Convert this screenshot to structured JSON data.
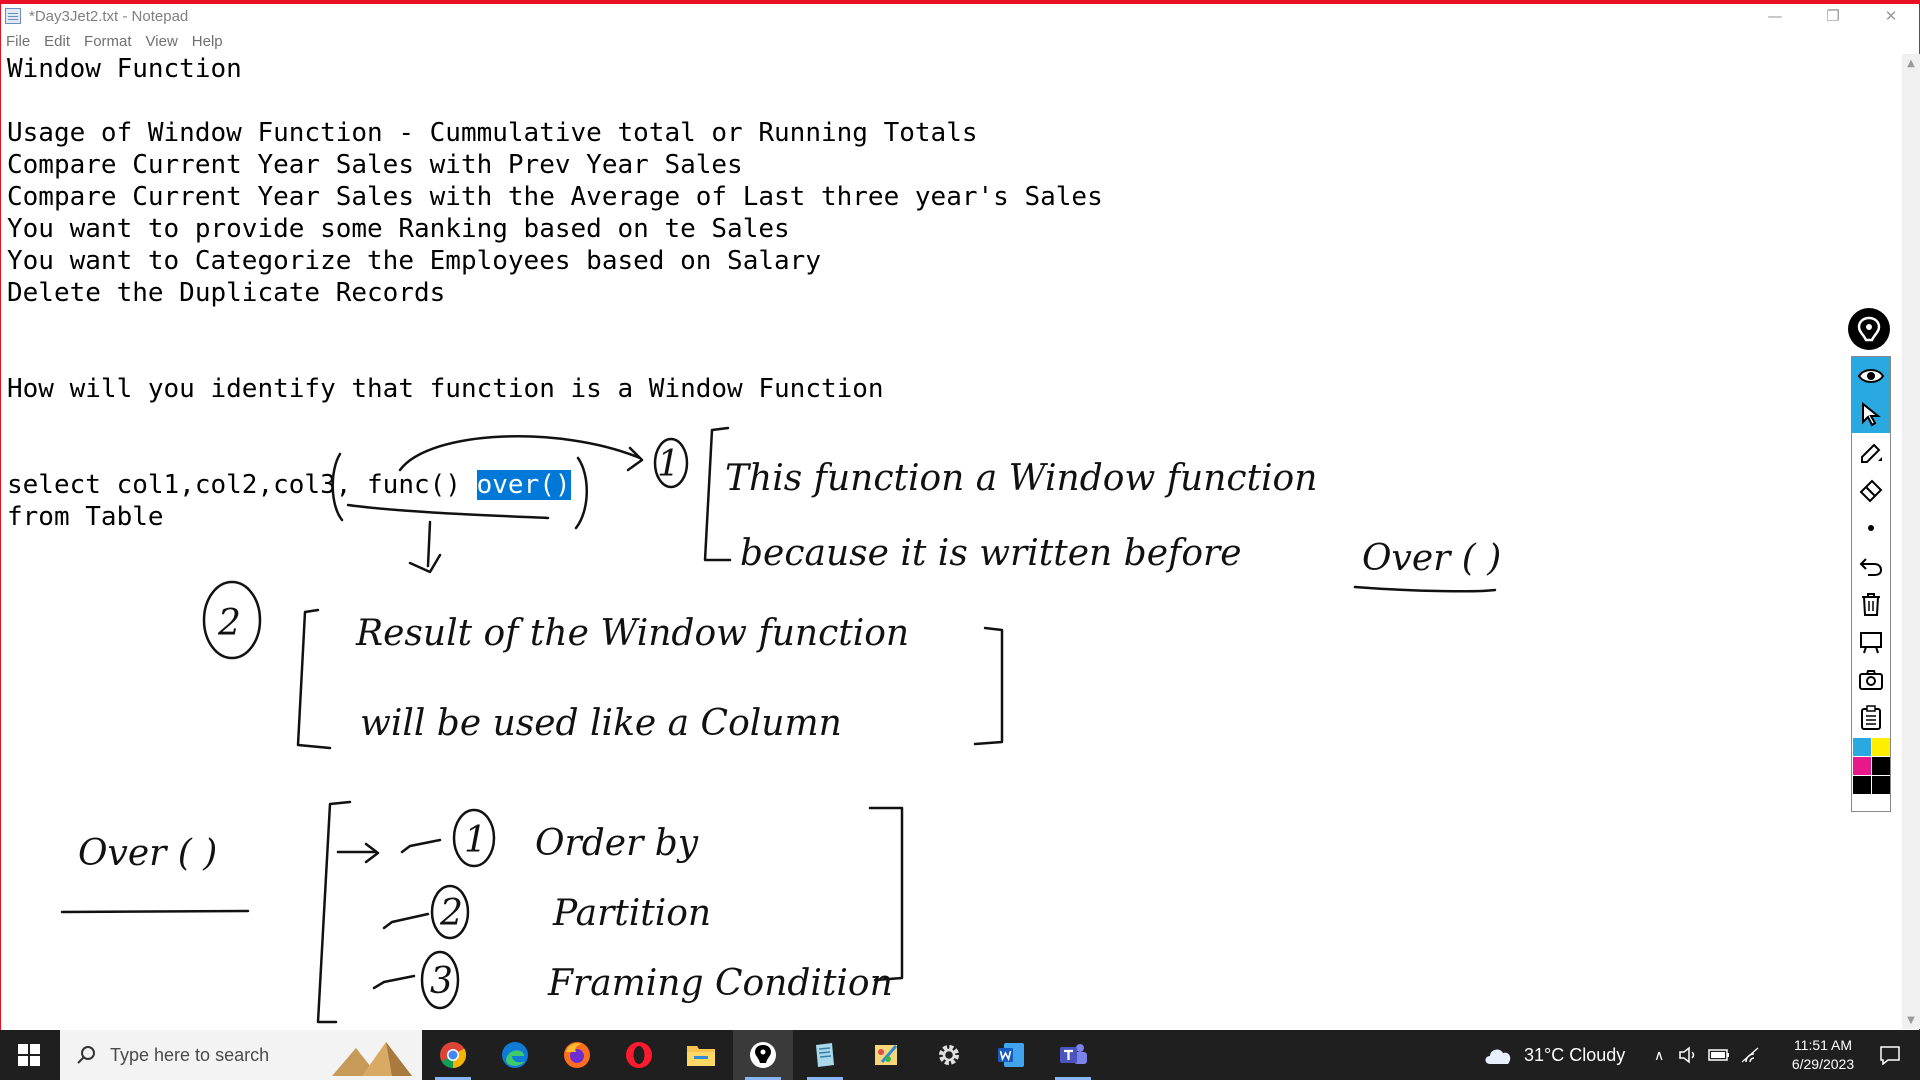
{
  "window": {
    "title": "*Day3Jet2.txt - Notepad",
    "controls": {
      "minimize": "—",
      "maximize": "❐",
      "close": "✕"
    }
  },
  "menu": [
    "File",
    "Edit",
    "Format",
    "View",
    "Help"
  ],
  "editor": {
    "lines": [
      "Window Function",
      "Usage of Window Function - Cummulative total or Running Totals",
      "Compare Current Year Sales with Prev Year Sales",
      "Compare Current Year Sales with the Average of Last three year's Sales",
      "You want to provide some Ranking based on te Sales",
      "You want to Categorize the Employees based on Salary",
      "Delete the Duplicate Records",
      "How will you identify that function is a Window Function",
      "from Table"
    ],
    "select_line": {
      "before": "select col1,col2,col3, func() ",
      "selected": "over()"
    }
  },
  "annotations": {
    "n1": "1",
    "n1_line1": "This function a Window function",
    "n1_line2": "because it is written before",
    "n1_over": "Over ( )",
    "n2": "2",
    "n2_line1": "Result of the Window function",
    "n2_line2": "will be used like a Column",
    "over_heading": "Over ( )",
    "item1_num": "1",
    "item1": "Order by",
    "item2_num": "2",
    "item2": "Partition",
    "item3_num": "3",
    "item3": "Framing Condition"
  },
  "pen_toolbar": {
    "tools": [
      "eye-icon",
      "pointer-icon",
      "pen-icon",
      "eraser-icon",
      "dot-icon",
      "undo-icon",
      "trash-icon",
      "board-icon",
      "camera-icon",
      "clipboard-icon"
    ],
    "colors": [
      "#2aa8e0",
      "#ffee00",
      "#e8178a",
      "#000000",
      "#000000",
      "#000000"
    ]
  },
  "taskbar": {
    "search_placeholder": "Type here to search",
    "apps": [
      "chrome-icon",
      "edge-icon",
      "firefox-icon",
      "opera-icon",
      "file-explorer-icon",
      "pen-app-icon",
      "notepad-icon",
      "paint-icon",
      "settings-icon",
      "word-icon",
      "teams-icon"
    ],
    "weather": "31°C  Cloudy",
    "time": "11:51 AM",
    "date": "6/29/2023"
  }
}
